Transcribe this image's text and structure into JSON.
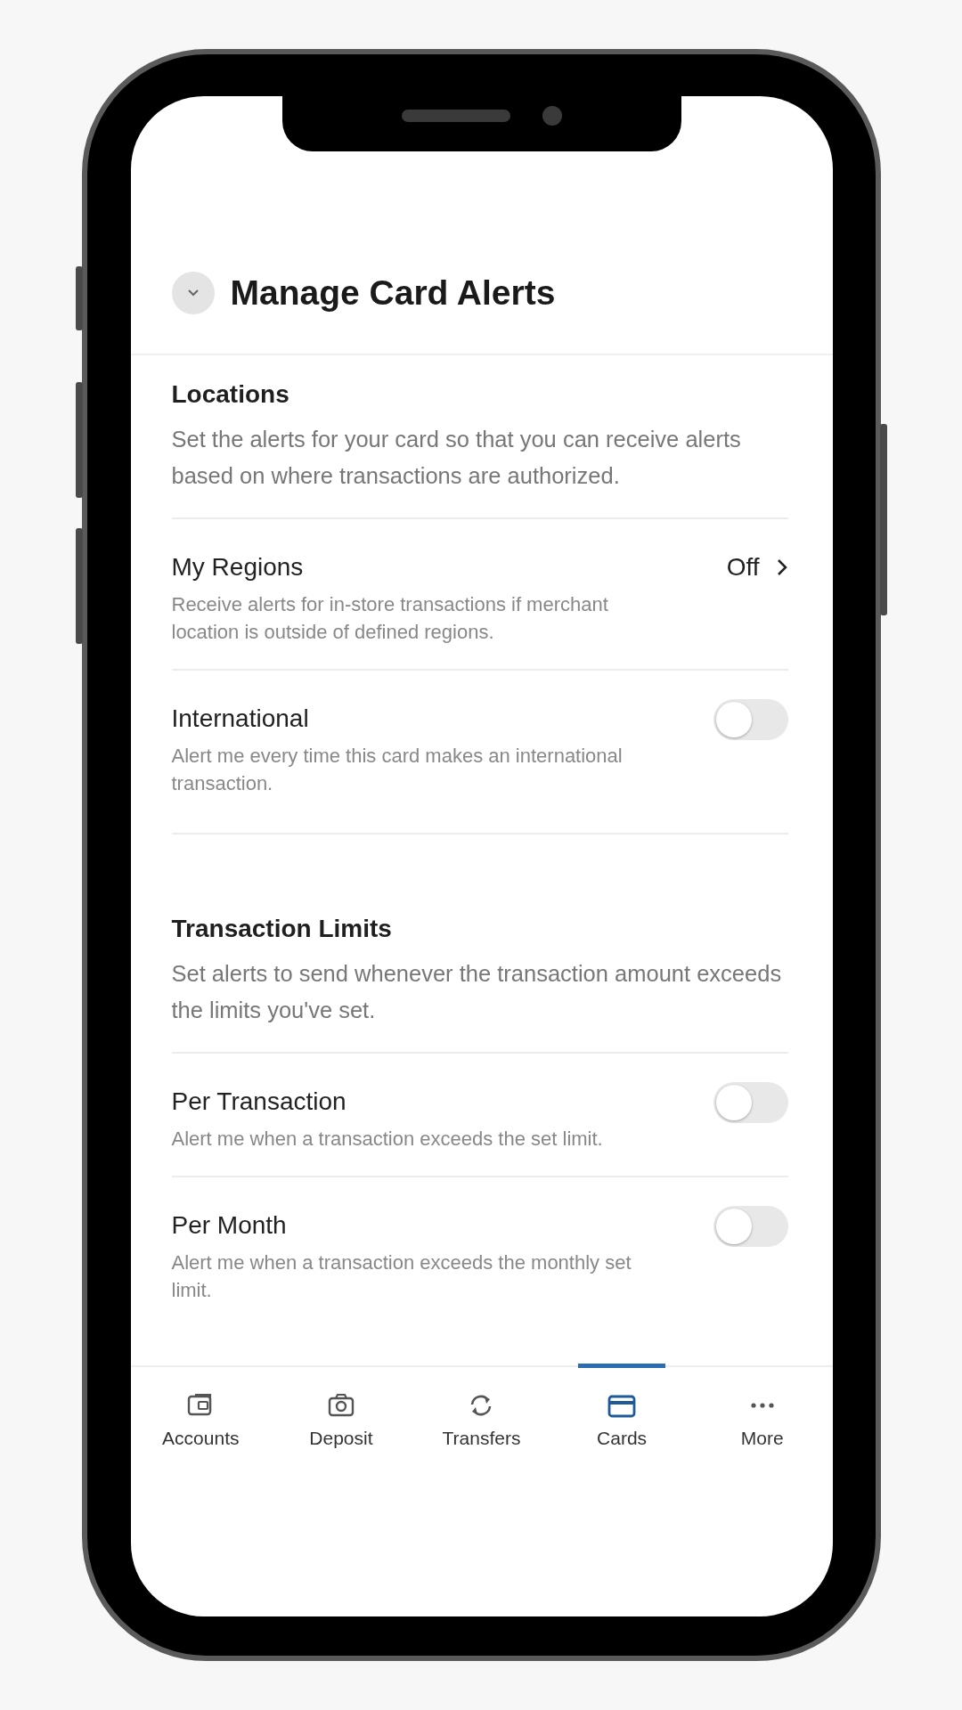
{
  "header": {
    "title": "Manage Card Alerts"
  },
  "sections": [
    {
      "title": "Locations",
      "description": "Set the alerts for your card so that you can receive alerts based on where transactions are authorized.",
      "items": [
        {
          "kind": "link",
          "title": "My Regions",
          "subtitle": "Receive alerts for in-store transactions if merchant location is outside of defined regions.",
          "value": "Off"
        },
        {
          "kind": "toggle",
          "title": "International",
          "subtitle": "Alert me every time this card makes an international transaction.",
          "on": false
        }
      ]
    },
    {
      "title": "Transaction Limits",
      "description": "Set alerts to send whenever the transaction amount exceeds the limits you've set.",
      "items": [
        {
          "kind": "toggle",
          "title": "Per Transaction",
          "subtitle": "Alert me when a transaction exceeds the set limit.",
          "on": false
        },
        {
          "kind": "toggle",
          "title": "Per Month",
          "subtitle": "Alert me when a transaction exceeds the monthly set limit.",
          "on": false
        }
      ]
    }
  ],
  "tabs": [
    {
      "kind": "accounts",
      "label": "Accounts",
      "selected": false
    },
    {
      "kind": "deposit",
      "label": "Deposit",
      "selected": false
    },
    {
      "kind": "transfers",
      "label": "Transfers",
      "selected": false
    },
    {
      "kind": "cards",
      "label": "Cards",
      "selected": true
    },
    {
      "kind": "more",
      "label": "More",
      "selected": false
    }
  ]
}
